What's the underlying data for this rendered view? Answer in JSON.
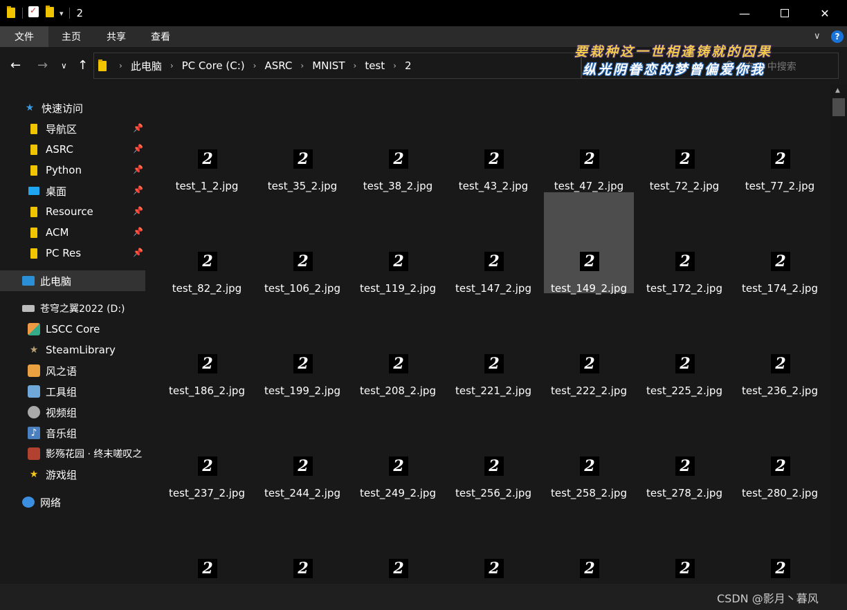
{
  "window": {
    "title": "2",
    "minimize": "—",
    "close": "✕"
  },
  "ribbon": {
    "tabs": [
      "文件",
      "主页",
      "共享",
      "查看"
    ],
    "chevron": "∨",
    "help": "?"
  },
  "nav": {
    "back": "←",
    "forward": "→",
    "recent": "∨",
    "up": "↑"
  },
  "address": {
    "crumbs": [
      "此电脑",
      "PC Core (C:)",
      "ASRC",
      "MNIST",
      "test",
      "2"
    ],
    "separator": "›"
  },
  "search": {
    "placeholder": "在 2 中搜索"
  },
  "overlay_lyric": {
    "line1": "要栽种这一世相逢铸就的因果",
    "line2": "纵光阴眷恋的梦曾偏爱你我"
  },
  "sidebar": {
    "quick_access": "快速访问",
    "pinned": [
      "导航区",
      "ASRC",
      "Python",
      "桌面",
      "Resource",
      "ACM",
      "PC Res"
    ],
    "this_pc": "此电脑",
    "drive": "苍穹之翼2022 (D:)",
    "libraries": [
      "LSCC Core",
      "SteamLibrary",
      "风之语",
      "工具组",
      "视频组",
      "音乐组",
      "影殇花园 · 终末嗟叹之",
      "游戏组"
    ],
    "network": "网络"
  },
  "files": {
    "rows": [
      [
        "test_1_2.jpg",
        "test_35_2.jpg",
        "test_38_2.jpg",
        "test_43_2.jpg",
        "test_47_2.jpg",
        "test_72_2.jpg",
        "test_77_2.jpg"
      ],
      [
        "test_82_2.jpg",
        "test_106_2.jpg",
        "test_119_2.jpg",
        "test_147_2.jpg",
        "test_149_2.jpg",
        "test_172_2.jpg",
        "test_174_2.jpg"
      ],
      [
        "test_186_2.jpg",
        "test_199_2.jpg",
        "test_208_2.jpg",
        "test_221_2.jpg",
        "test_222_2.jpg",
        "test_225_2.jpg",
        "test_236_2.jpg"
      ],
      [
        "test_237_2.jpg",
        "test_244_2.jpg",
        "test_249_2.jpg",
        "test_256_2.jpg",
        "test_258_2.jpg",
        "test_278_2.jpg",
        "test_280_2.jpg"
      ],
      [
        "",
        "",
        "",
        "",
        "",
        "",
        ""
      ]
    ],
    "thumb_glyph": "2",
    "selected": "test_149_2.jpg"
  },
  "watermark": "CSDN @影月丶暮风"
}
